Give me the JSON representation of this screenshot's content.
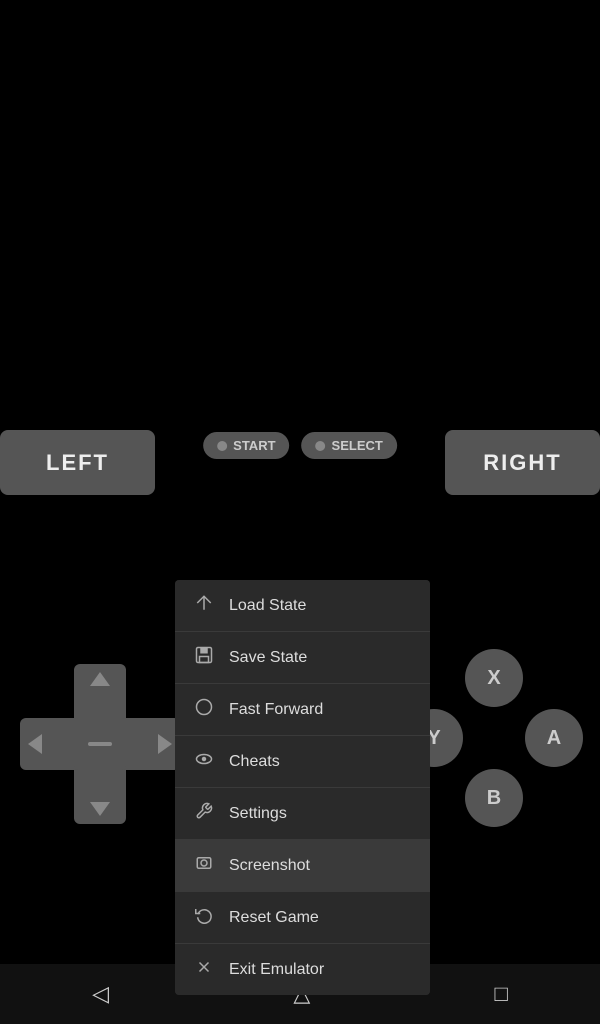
{
  "topBar": {
    "shareIcon": "↗",
    "saveIcon": "💾"
  },
  "controller": {
    "leftLabel": "LEFT",
    "rightLabel": "RIGHT",
    "startLabel": "START",
    "selectLabel": "SELECT",
    "xLabel": "X",
    "aLabel": "A",
    "bLabel": "B",
    "yLabel": "Y"
  },
  "menu": {
    "items": [
      {
        "id": "load-state",
        "icon": "↗",
        "label": "Load State",
        "active": false
      },
      {
        "id": "save-state",
        "icon": "💾",
        "label": "Save State",
        "active": false
      },
      {
        "id": "fast-forward",
        "icon": "⏱",
        "label": "Fast Forward",
        "active": false
      },
      {
        "id": "cheats",
        "icon": "👁",
        "label": "Cheats",
        "active": false
      },
      {
        "id": "settings",
        "icon": "🔧",
        "label": "Settings",
        "active": false
      },
      {
        "id": "screenshot",
        "icon": "🖼",
        "label": "Screenshot",
        "active": true
      },
      {
        "id": "reset-game",
        "icon": "↺",
        "label": "Reset Game",
        "active": false
      },
      {
        "id": "exit-emulator",
        "icon": "✕",
        "label": "Exit Emulator",
        "active": false
      }
    ]
  },
  "bottomNav": {
    "backIcon": "◁",
    "homeIcon": "△",
    "recentIcon": "□"
  }
}
